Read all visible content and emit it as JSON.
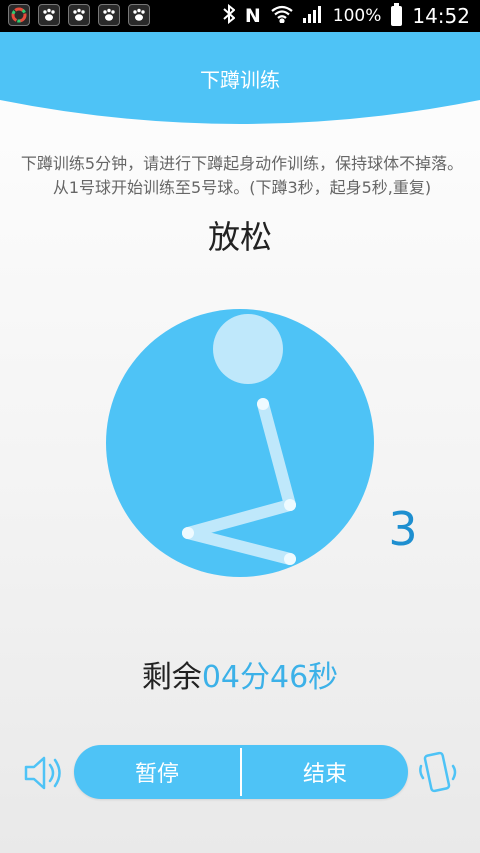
{
  "status_bar": {
    "battery": "100%",
    "time": "14:52",
    "network": "N"
  },
  "header": {
    "title": "下蹲训练"
  },
  "instructions": "下蹲训练5分钟，请进行下蹲起身动作训练，保持球体不掉落。从1号球开始训练至5号球。(下蹲3秒，起身5秒,重复)",
  "phase_label": "放松",
  "count": "3",
  "remaining": {
    "label": "剩余",
    "time": "04分46秒"
  },
  "controls": {
    "pause_label": "暂停",
    "end_label": "结束"
  },
  "colors": {
    "accent": "#4ec3f6",
    "count_text": "#1e8fd0",
    "time_text": "#3cb1e8"
  }
}
